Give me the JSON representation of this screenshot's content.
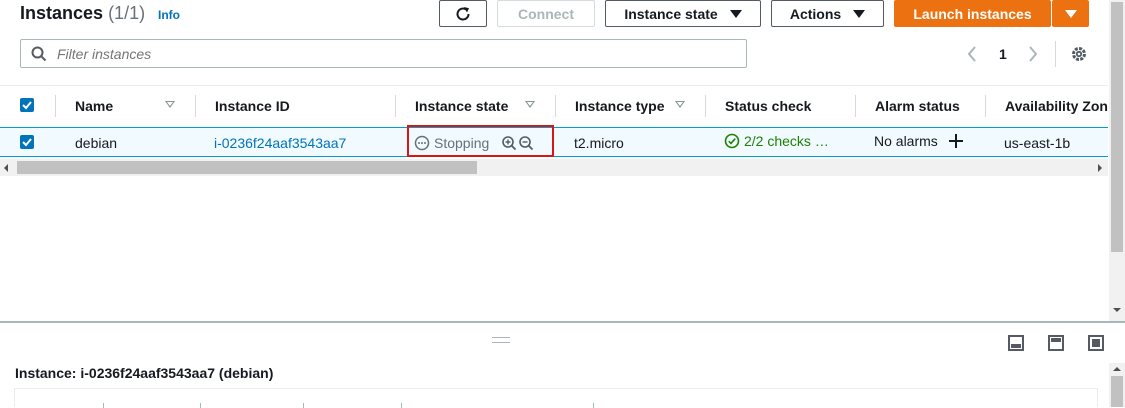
{
  "header": {
    "title": "Instances",
    "count": "(1/1)",
    "info": "Info"
  },
  "toolbar": {
    "connect": "Connect",
    "instance_state": "Instance state",
    "actions": "Actions",
    "launch": "Launch instances"
  },
  "search": {
    "placeholder": "Filter instances"
  },
  "pagination": {
    "page": "1"
  },
  "table": {
    "columns": [
      "Name",
      "Instance ID",
      "Instance state",
      "Instance type",
      "Status check",
      "Alarm status",
      "Availability Zon"
    ],
    "row": {
      "name": "debian",
      "instance_id": "i-0236f24aaf3543aa7",
      "state": "Stopping",
      "type": "t2.micro",
      "status_check": "2/2 checks …",
      "alarm": "No alarms",
      "az": "us-east-1b"
    }
  },
  "detail": {
    "title": "Instance: i-0236f24aaf3543aa7 (debian)"
  },
  "colors": {
    "accent": "#ec7211",
    "link": "#0073bb",
    "success": "#1d8102",
    "highlight_box": "#d91515"
  }
}
